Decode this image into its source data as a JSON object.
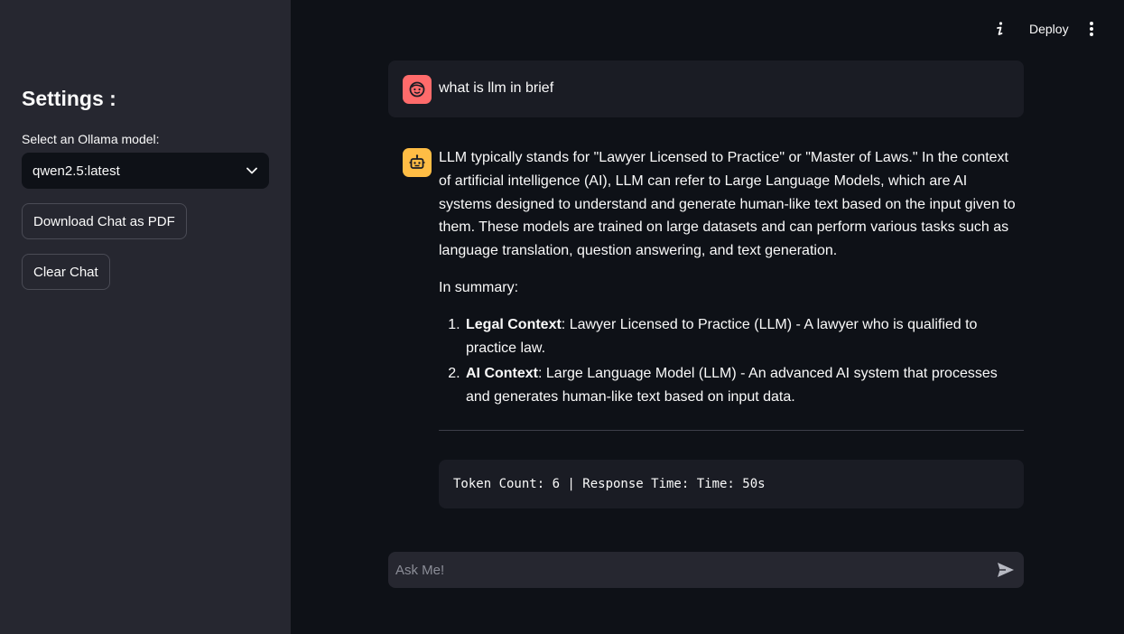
{
  "sidebar": {
    "title": "Settings :",
    "model_label": "Select an Ollama model:",
    "model_selected": "qwen2.5:latest",
    "download_button": "Download Chat as PDF",
    "clear_button": "Clear Chat"
  },
  "header": {
    "deploy_label": "Deploy"
  },
  "chat": {
    "user_message": "what is llm in brief",
    "assistant": {
      "paragraph_1": "LLM typically stands for \"Lawyer Licensed to Practice\" or \"Master of Laws.\" In the context of artificial intelligence (AI), LLM can refer to Large Language Models, which are AI systems designed to understand and generate human-like text based on the input given to them. These models are trained on large datasets and can perform various tasks such as language translation, question answering, and text generation.",
      "paragraph_2": "In summary:",
      "list": [
        {
          "bold": "Legal Context",
          "text": ": Lawyer Licensed to Practice (LLM) - A lawyer who is qualified to practice law."
        },
        {
          "bold": "AI Context",
          "text": ": Large Language Model (LLM) - An advanced AI system that processes and generates human-like text based on input data."
        }
      ],
      "stats": "Token Count: 6 | Response Time: Time: 50s"
    }
  },
  "input": {
    "placeholder": "Ask Me!"
  },
  "colors": {
    "background": "#0e1117",
    "sidebar": "#262730",
    "user_avatar": "#ff6b6b",
    "bot_avatar": "#ffbd45"
  },
  "icons": {
    "user_avatar": "face-icon",
    "bot_avatar": "robot-icon",
    "info": "info-icon",
    "menu": "kebab-menu-icon",
    "dropdown": "chevron-down-icon",
    "send": "send-icon"
  }
}
